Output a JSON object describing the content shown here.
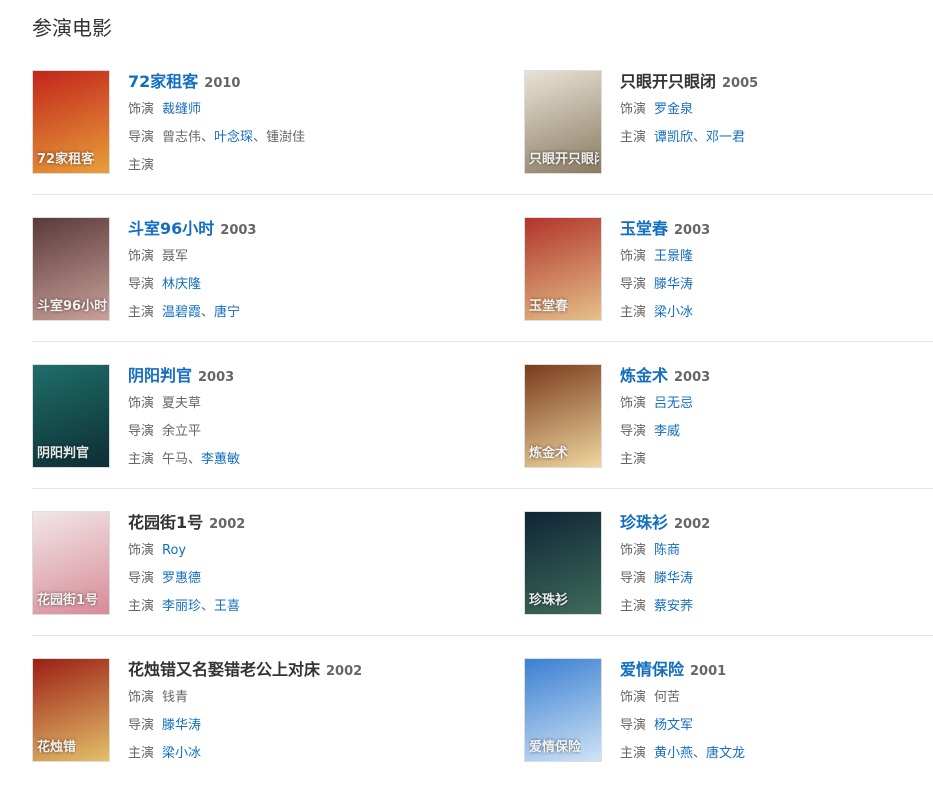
{
  "section_title": "参演电影",
  "labels": {
    "role": "饰演",
    "director": "导演",
    "cast": "主演"
  },
  "movies": [
    {
      "title": "72家租客",
      "year": "2010",
      "title_link": true,
      "role": [
        {
          "t": "裁缝师",
          "link": true
        }
      ],
      "director": [
        {
          "t": "曾志伟",
          "link": false
        },
        {
          "t": "、",
          "sep": true
        },
        {
          "t": "叶念琛",
          "link": true
        },
        {
          "t": "、",
          "sep": true
        },
        {
          "t": "锺澍佳",
          "link": false
        }
      ],
      "cast": [],
      "poster": {
        "colors": [
          "#c2241c",
          "#e8a03a"
        ],
        "text": "72家租客"
      }
    },
    {
      "title": "只眼开只眼闭",
      "year": "2005",
      "title_link": false,
      "role": [
        {
          "t": "罗金泉",
          "link": true
        }
      ],
      "director": [
        {
          "t": "谭凯欣",
          "link": true
        },
        {
          "t": "、",
          "sep": true
        },
        {
          "t": "邓一君",
          "link": true
        }
      ],
      "director_label": "cast",
      "cast": null,
      "poster": {
        "colors": [
          "#e9e3d6",
          "#8a7a62"
        ],
        "text": "只眼开只眼闭"
      }
    },
    {
      "title": "斗室96小时",
      "year": "2003",
      "title_link": true,
      "role": [
        {
          "t": "聂军",
          "link": false
        }
      ],
      "director": [
        {
          "t": "林庆隆",
          "link": true
        }
      ],
      "cast": [
        {
          "t": "温碧霞",
          "link": true
        },
        {
          "t": "、",
          "sep": true
        },
        {
          "t": "唐宁",
          "link": true
        }
      ],
      "poster": {
        "colors": [
          "#5a3a3a",
          "#c9a19a"
        ],
        "text": "斗室96小时"
      }
    },
    {
      "title": "玉堂春",
      "year": "2003",
      "title_link": true,
      "role": [
        {
          "t": "王景隆",
          "link": true
        }
      ],
      "director": [
        {
          "t": "滕华涛",
          "link": true
        }
      ],
      "cast": [
        {
          "t": "梁小冰",
          "link": true
        }
      ],
      "poster": {
        "colors": [
          "#b0342a",
          "#e6c08a"
        ],
        "text": "玉堂春"
      }
    },
    {
      "title": "阴阳判官",
      "year": "2003",
      "title_link": true,
      "role": [
        {
          "t": "夏夫草",
          "link": false
        }
      ],
      "director": [
        {
          "t": "余立平",
          "link": false
        }
      ],
      "cast": [
        {
          "t": "午马",
          "link": false
        },
        {
          "t": "、",
          "sep": true
        },
        {
          "t": "李蕙敏",
          "link": true
        }
      ],
      "poster": {
        "colors": [
          "#1f6e6a",
          "#0d2d33"
        ],
        "text": "阴阳判官"
      }
    },
    {
      "title": "炼金术",
      "year": "2003",
      "title_link": true,
      "role": [
        {
          "t": "吕无忌",
          "link": true
        }
      ],
      "director": [
        {
          "t": "李威",
          "link": true
        }
      ],
      "cast": [],
      "poster": {
        "colors": [
          "#7a3b1c",
          "#f0d7a0"
        ],
        "text": "炼金术"
      }
    },
    {
      "title": "花园街1号",
      "year": "2002",
      "title_link": false,
      "role": [
        {
          "t": "Roy",
          "link": true
        }
      ],
      "director": [
        {
          "t": "罗惠德",
          "link": true
        }
      ],
      "cast": [
        {
          "t": "李丽珍",
          "link": true
        },
        {
          "t": "、",
          "sep": true
        },
        {
          "t": "王喜",
          "link": true
        }
      ],
      "poster": {
        "colors": [
          "#f1e6e8",
          "#d78b97"
        ],
        "text": "花园街1号"
      }
    },
    {
      "title": "珍珠衫",
      "year": "2002",
      "title_link": true,
      "role": [
        {
          "t": "陈商",
          "link": true
        }
      ],
      "director": [
        {
          "t": "滕华涛",
          "link": true
        }
      ],
      "cast": [
        {
          "t": "蔡安荞",
          "link": true
        }
      ],
      "poster": {
        "colors": [
          "#0f2536",
          "#3f6b5a"
        ],
        "text": "珍珠衫"
      }
    },
    {
      "title": "花烛错又名娶错老公上对床",
      "year": "2002",
      "title_link": false,
      "role": [
        {
          "t": "钱青",
          "link": false
        }
      ],
      "director": [
        {
          "t": "滕华涛",
          "link": true
        }
      ],
      "cast": [
        {
          "t": "梁小冰",
          "link": true
        }
      ],
      "poster": {
        "colors": [
          "#9c1f16",
          "#e3c06a"
        ],
        "text": "花烛错"
      }
    },
    {
      "title": "爱情保险",
      "year": "2001",
      "title_link": true,
      "role": [
        {
          "t": "何苦",
          "link": false
        }
      ],
      "director": [
        {
          "t": "杨文军",
          "link": true
        }
      ],
      "cast": [
        {
          "t": "黄小燕",
          "link": true
        },
        {
          "t": "、",
          "sep": true
        },
        {
          "t": "唐文龙",
          "link": true
        }
      ],
      "poster": {
        "colors": [
          "#3a7fd1",
          "#cfe3f7"
        ],
        "text": "爱情保险"
      }
    }
  ]
}
